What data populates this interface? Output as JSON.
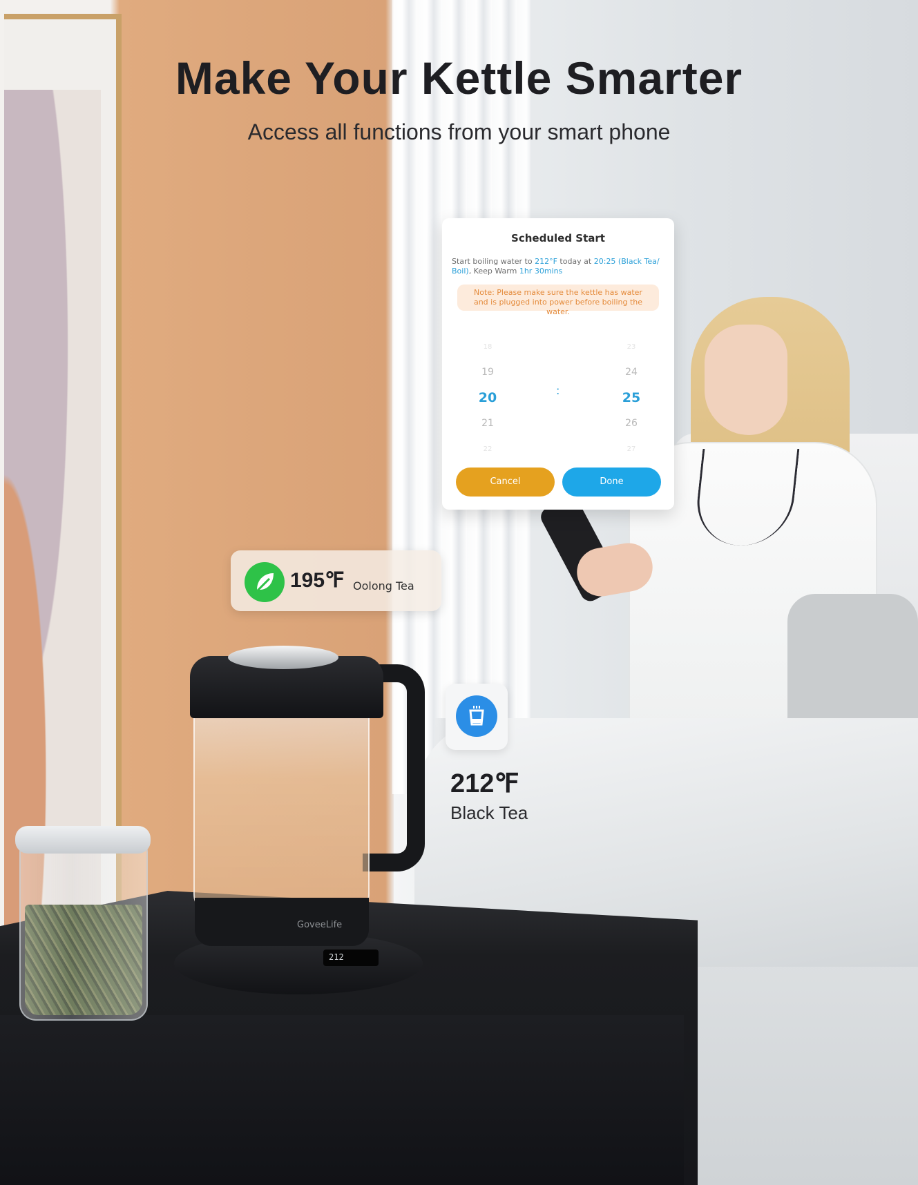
{
  "headline": "Make Your Kettle Smarter",
  "subheadline": "Access all functions from your smart phone",
  "dialog": {
    "title": "Scheduled Start",
    "body_prefix": "Start boiling water to ",
    "temperature": "212°F",
    "body_mid": " today at ",
    "time_preset": "20:25 (Black Tea/ Boil)",
    "body_mid2": ", Keep Warm ",
    "keep_warm": "1hr 30mins",
    "note": "Note: Please make sure the kettle has water and is plugged into power before boiling the water.",
    "hours": [
      "18",
      "19",
      "20",
      "21",
      "22"
    ],
    "minutes": [
      "23",
      "24",
      "25",
      "26",
      "27"
    ],
    "separator": ":",
    "cancel_label": "Cancel",
    "done_label": "Done"
  },
  "oolong_card": {
    "icon": "leaf-icon",
    "temperature": "195℉",
    "name": "Oolong Tea"
  },
  "black_tea": {
    "icon": "cup-icon",
    "temperature": "212℉",
    "name": "Black Tea"
  },
  "kettle": {
    "brand": "GoveeLife",
    "display": "212"
  },
  "colors": {
    "accent_blue": "#1ea7e8",
    "cancel_orange": "#e5a11f",
    "leaf_green": "#2ec248",
    "cup_blue": "#2b8ee6"
  }
}
